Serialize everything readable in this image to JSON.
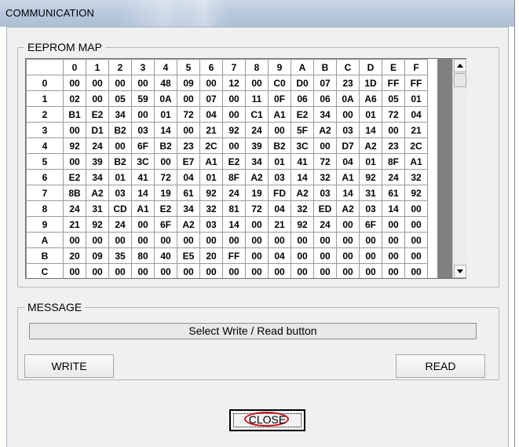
{
  "window": {
    "title": "COMMUNICATION"
  },
  "eeprom_map": {
    "legend": "EEPROM MAP",
    "columns": [
      "0",
      "1",
      "2",
      "3",
      "4",
      "5",
      "6",
      "7",
      "8",
      "9",
      "A",
      "B",
      "C",
      "D",
      "E",
      "F"
    ],
    "rows": [
      {
        "label": "0",
        "cells": [
          "00",
          "00",
          "00",
          "00",
          "48",
          "09",
          "00",
          "12",
          "00",
          "C0",
          "D0",
          "07",
          "23",
          "1D",
          "FF",
          "FF"
        ]
      },
      {
        "label": "1",
        "cells": [
          "02",
          "00",
          "05",
          "59",
          "0A",
          "00",
          "07",
          "00",
          "11",
          "0F",
          "06",
          "06",
          "0A",
          "A6",
          "05",
          "01"
        ]
      },
      {
        "label": "2",
        "cells": [
          "B1",
          "E2",
          "34",
          "00",
          "01",
          "72",
          "04",
          "00",
          "C1",
          "A1",
          "E2",
          "34",
          "00",
          "01",
          "72",
          "04"
        ]
      },
      {
        "label": "3",
        "cells": [
          "00",
          "D1",
          "B2",
          "03",
          "14",
          "00",
          "21",
          "92",
          "24",
          "00",
          "5F",
          "A2",
          "03",
          "14",
          "00",
          "21"
        ]
      },
      {
        "label": "4",
        "cells": [
          "92",
          "24",
          "00",
          "6F",
          "B2",
          "23",
          "2C",
          "00",
          "39",
          "B2",
          "3C",
          "00",
          "D7",
          "A2",
          "23",
          "2C"
        ]
      },
      {
        "label": "5",
        "cells": [
          "00",
          "39",
          "B2",
          "3C",
          "00",
          "E7",
          "A1",
          "E2",
          "34",
          "01",
          "41",
          "72",
          "04",
          "01",
          "8F",
          "A1"
        ]
      },
      {
        "label": "6",
        "cells": [
          "E2",
          "34",
          "01",
          "41",
          "72",
          "04",
          "01",
          "8F",
          "A2",
          "03",
          "14",
          "32",
          "A1",
          "92",
          "24",
          "32"
        ]
      },
      {
        "label": "7",
        "cells": [
          "8B",
          "A2",
          "03",
          "14",
          "19",
          "61",
          "92",
          "24",
          "19",
          "FD",
          "A2",
          "03",
          "14",
          "31",
          "61",
          "92"
        ]
      },
      {
        "label": "8",
        "cells": [
          "24",
          "31",
          "CD",
          "A1",
          "E2",
          "34",
          "32",
          "81",
          "72",
          "04",
          "32",
          "ED",
          "A2",
          "03",
          "14",
          "00"
        ]
      },
      {
        "label": "9",
        "cells": [
          "21",
          "92",
          "24",
          "00",
          "6F",
          "A2",
          "03",
          "14",
          "00",
          "21",
          "92",
          "24",
          "00",
          "6F",
          "00",
          "00"
        ]
      },
      {
        "label": "A",
        "cells": [
          "00",
          "00",
          "00",
          "00",
          "00",
          "00",
          "00",
          "00",
          "00",
          "00",
          "00",
          "00",
          "00",
          "00",
          "00",
          "00"
        ]
      },
      {
        "label": "B",
        "cells": [
          "20",
          "09",
          "35",
          "80",
          "40",
          "E5",
          "20",
          "FF",
          "00",
          "04",
          "00",
          "00",
          "00",
          "00",
          "00",
          "00"
        ]
      },
      {
        "label": "C",
        "cells": [
          "00",
          "00",
          "00",
          "00",
          "00",
          "00",
          "00",
          "00",
          "00",
          "00",
          "00",
          "00",
          "00",
          "00",
          "00",
          "00"
        ]
      }
    ]
  },
  "message": {
    "legend": "MESSAGE",
    "text": "Select Write / Read button"
  },
  "buttons": {
    "write": "WRITE",
    "read": "READ",
    "close": "CLOSE"
  },
  "colors": {
    "highlight_ellipse": "#d0141b",
    "titlebar": "#b9c9dd"
  }
}
